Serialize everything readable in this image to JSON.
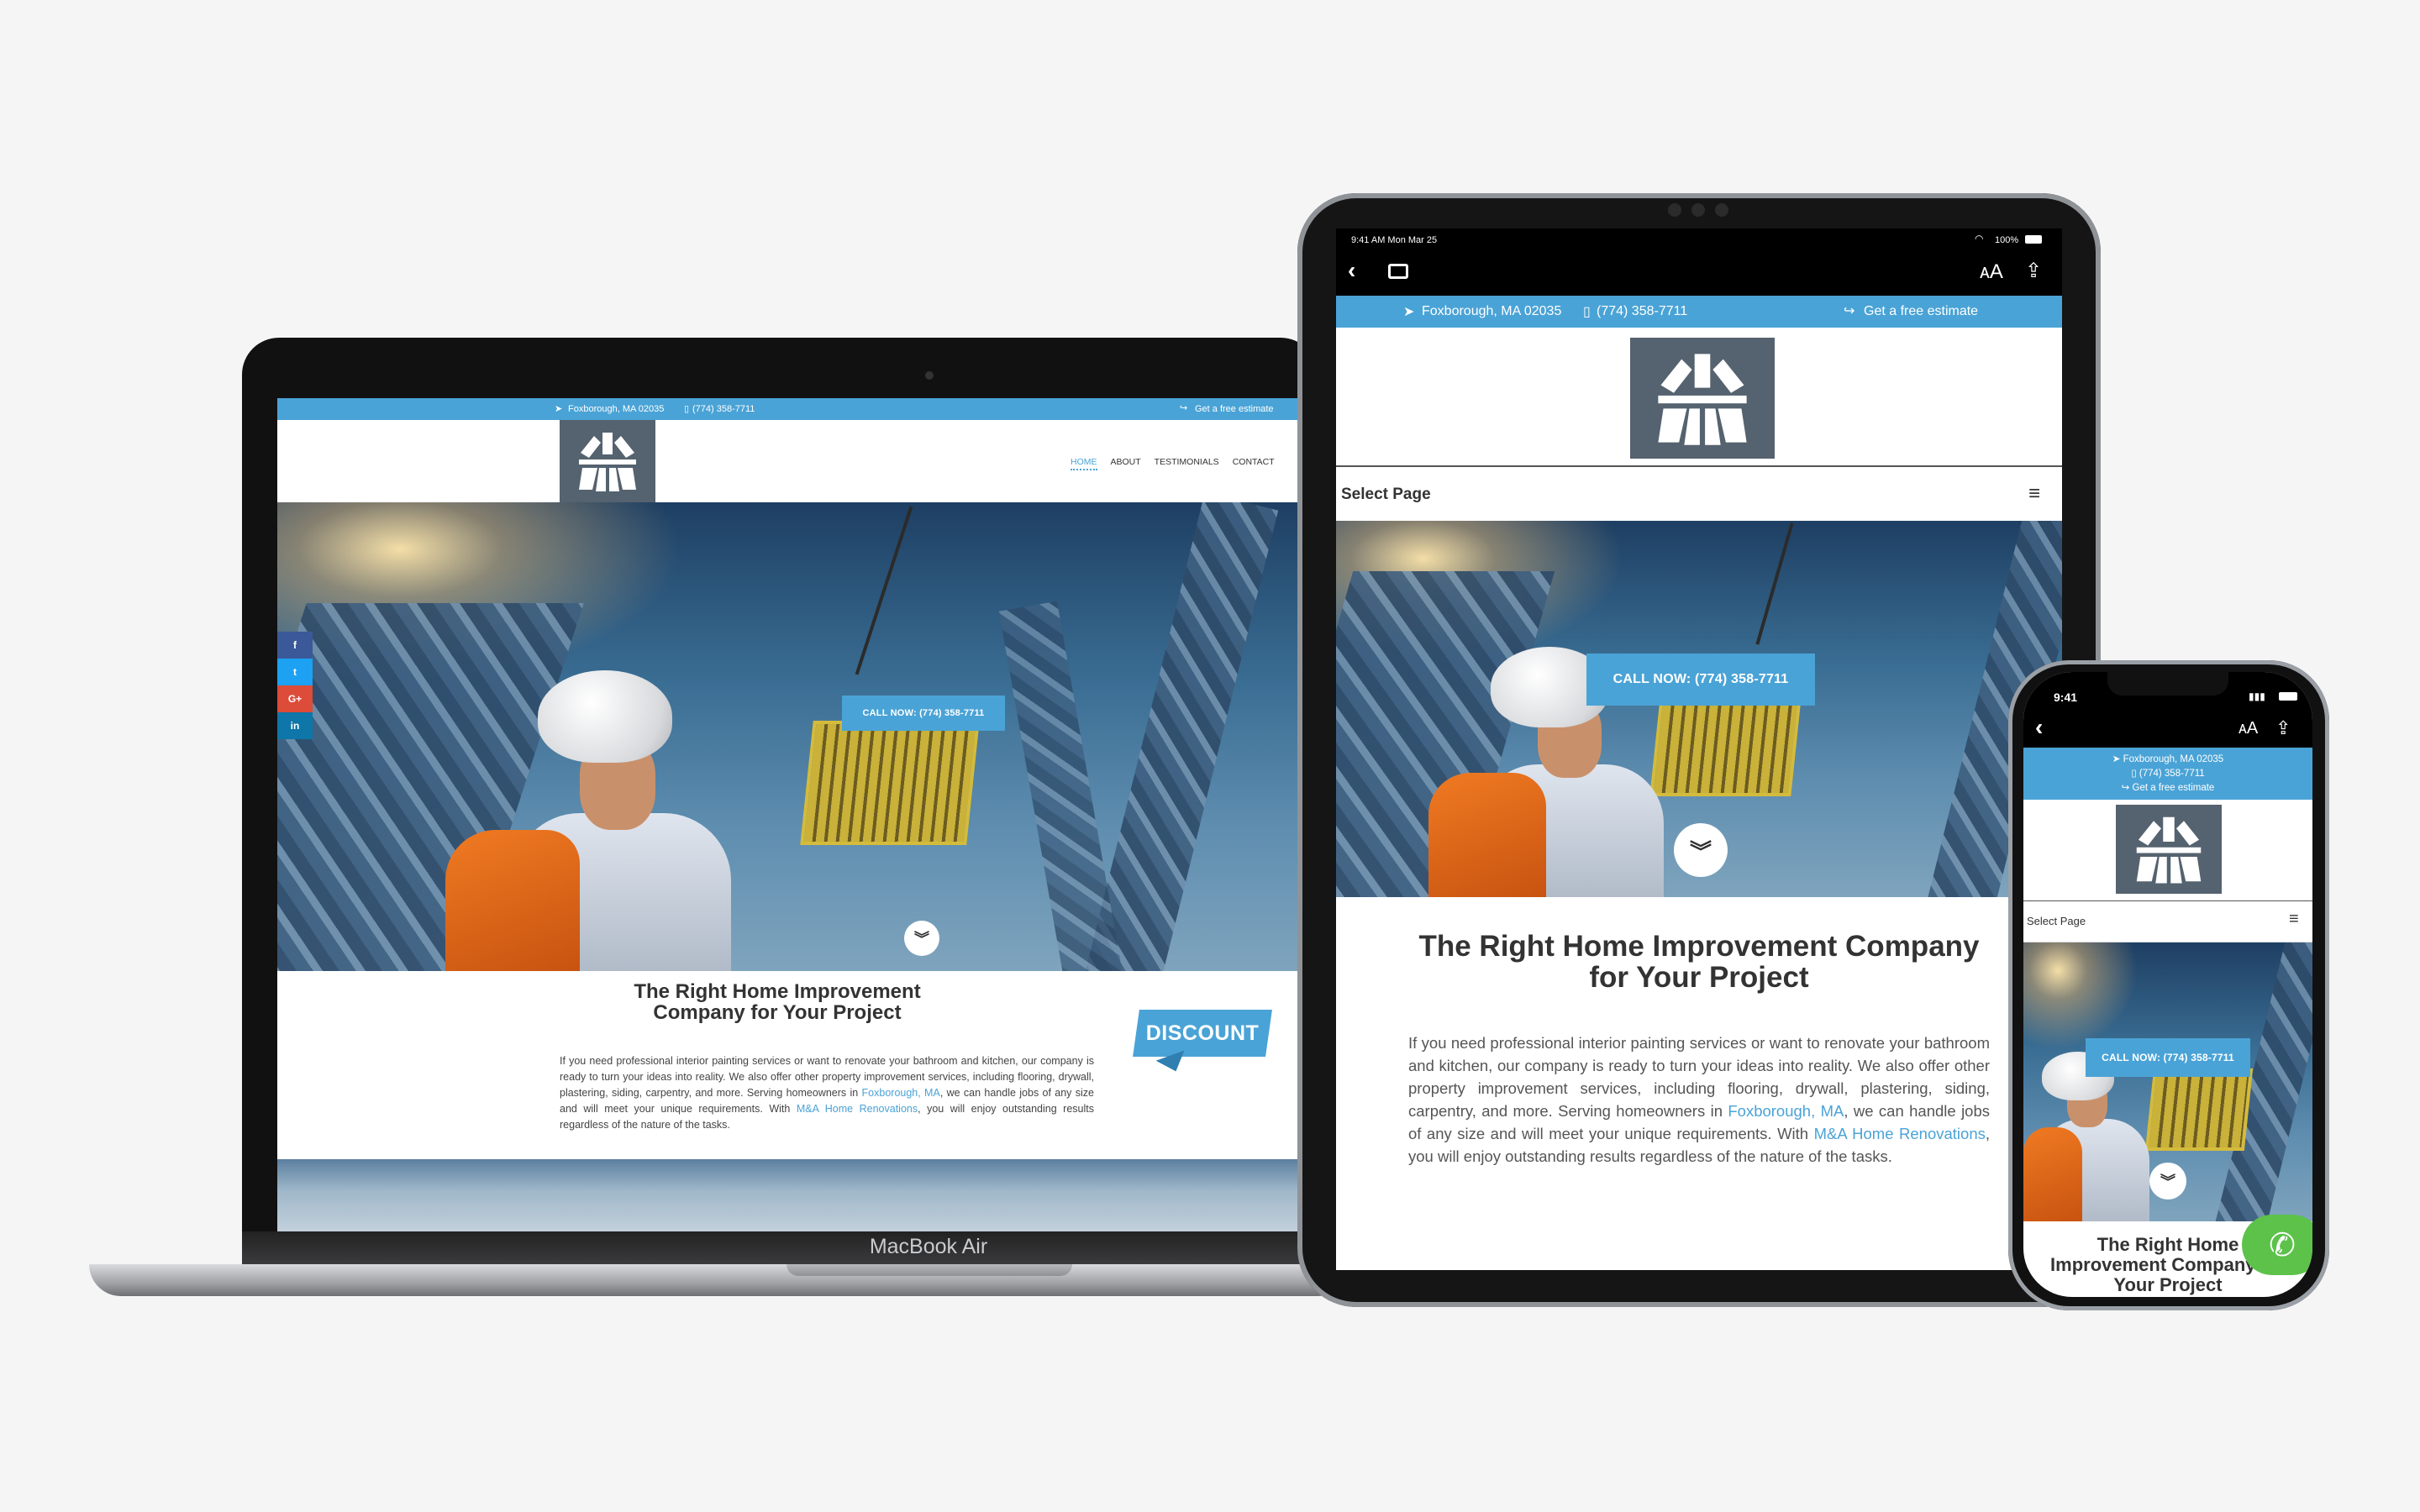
{
  "laptop": {
    "brand": "MacBook Air",
    "site": {
      "location": "Foxborough, MA 02035",
      "phone": "(774) 358-7711",
      "estimate": "Get a free estimate",
      "nav": [
        "HOME",
        "ABOUT",
        "TESTIMONIALS",
        "CONTACT"
      ],
      "social": [
        "f",
        "t",
        "G+",
        "in"
      ],
      "cta": "CALL NOW: (774) 358-7711",
      "heading": "The Right Home Improvement Company for Your Project",
      "discount": "DISCOUNT",
      "body_pre": "If you need professional interior painting services or want to renovate your bathroom and kitchen, our company is ready to turn your ideas into reality. We also offer other property improvement services, including flooring, drywall, plastering, siding, carpentry, and more. Serving homeowners in ",
      "link1": "Foxborough, MA",
      "body_mid": ", we can handle jobs of any size and will meet your unique requirements. With ",
      "link2": "M&A Home Renovations",
      "body_post": ", you will enjoy outstanding results regardless of the nature of the tasks."
    }
  },
  "tablet": {
    "status": {
      "time": "9:41 AM  Mon Mar 25",
      "battery": "100%"
    },
    "site": {
      "location": "Foxborough, MA 02035",
      "phone": "(774) 358-7711",
      "estimate": "Get a free estimate",
      "select_page": "Select Page",
      "cta": "CALL NOW: (774) 358-7711",
      "heading": "The Right Home Improvement Company for Your Project",
      "body_pre": "If you need professional interior painting services or want to renovate your bathroom and kitchen, our company is ready to turn your ideas into reality. We also offer other property improvement services, including flooring, drywall, plastering, siding, carpentry, and more. Serving homeowners in ",
      "link1": "Foxborough, MA",
      "body_mid": ", we can handle jobs of any size and will meet your unique requirements. With ",
      "link2": "M&A Home Renovations",
      "body_post": ", you will enjoy outstanding results regardless of the nature of the tasks."
    }
  },
  "phone": {
    "status": {
      "time": "9:41"
    },
    "site": {
      "location": "Foxborough, MA 02035",
      "phone": "(774) 358-7711",
      "estimate": "Get a free estimate",
      "select_page": "Select Page",
      "cta": "CALL NOW: (774) 358-7711",
      "heading": "The Right Home Improvement Company for Your Project"
    }
  },
  "colors": {
    "accent": "#4aa3d6",
    "logo_bg": "#55626f",
    "call_button": "#5cc24a"
  }
}
